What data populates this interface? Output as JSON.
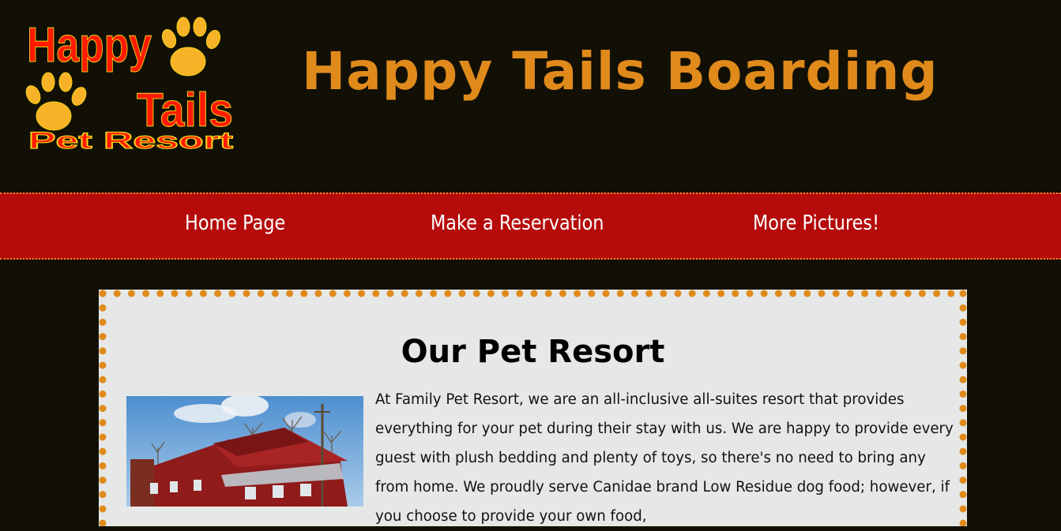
{
  "header": {
    "logo": {
      "line1": "Happy",
      "line2": "Tails",
      "line3": "Pet Resort",
      "icon": "paw-print-icon",
      "colors": {
        "text": "#ff1a00",
        "paws": "#f7b227",
        "outline": "#f6d21a"
      }
    },
    "site_title": "Happy Tails Boarding",
    "colors": {
      "background": "#121005",
      "title": "#e08a1c"
    }
  },
  "nav": {
    "items": [
      {
        "label": "Home Page"
      },
      {
        "label": "Make a Reservation"
      },
      {
        "label": "More Pictures!"
      }
    ],
    "colors": {
      "background": "#b50b0b",
      "border": "#e58a2a"
    }
  },
  "main": {
    "title": "Our Pet Resort",
    "photo": "resort-building-photo",
    "intro_text": "At Family Pet Resort, we are an all-inclusive all-suites resort that provides everything for your pet during their stay with us. We are happy to provide every guest with plush bedding and plenty of toys, so there's no need to bring any from home. We proudly serve Canidae brand Low Residue dog food; however, if you choose to provide your own food,",
    "colors": {
      "panel": "#e6e8e7",
      "dotted_border": "#e08a1c"
    }
  }
}
